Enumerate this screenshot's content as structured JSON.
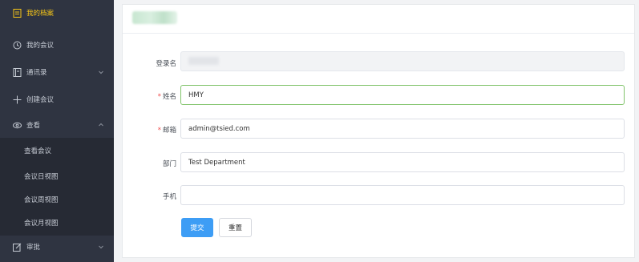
{
  "sidebar": {
    "items": [
      {
        "label": "我的档案",
        "icon": "document-icon",
        "active": true
      },
      {
        "label": "我的会议",
        "icon": "clock-icon"
      },
      {
        "label": "通讯录",
        "icon": "book-icon",
        "chevron": "down"
      },
      {
        "label": "创建会议",
        "icon": "plus-icon"
      },
      {
        "label": "查看",
        "icon": "eye-icon",
        "chevron": "up"
      },
      {
        "label": "查看会议",
        "sub": true
      },
      {
        "label": "会议日视图",
        "sub": true
      },
      {
        "label": "会议周视图",
        "sub": true
      },
      {
        "label": "会议月视图",
        "sub": true
      },
      {
        "label": "审批",
        "icon": "edit-icon",
        "chevron": "down"
      }
    ],
    "active_color": "#f5c518"
  },
  "form": {
    "username_label": "登录名",
    "name_label": "姓名",
    "name_value": "HMY",
    "email_label": "邮箱",
    "email_value": "admin@tsied.com",
    "dept_label": "部门",
    "dept_value": "Test Department",
    "phone_label": "手机",
    "phone_value": "",
    "required_mark": "*",
    "submit_label": "提交",
    "reset_label": "重置"
  }
}
